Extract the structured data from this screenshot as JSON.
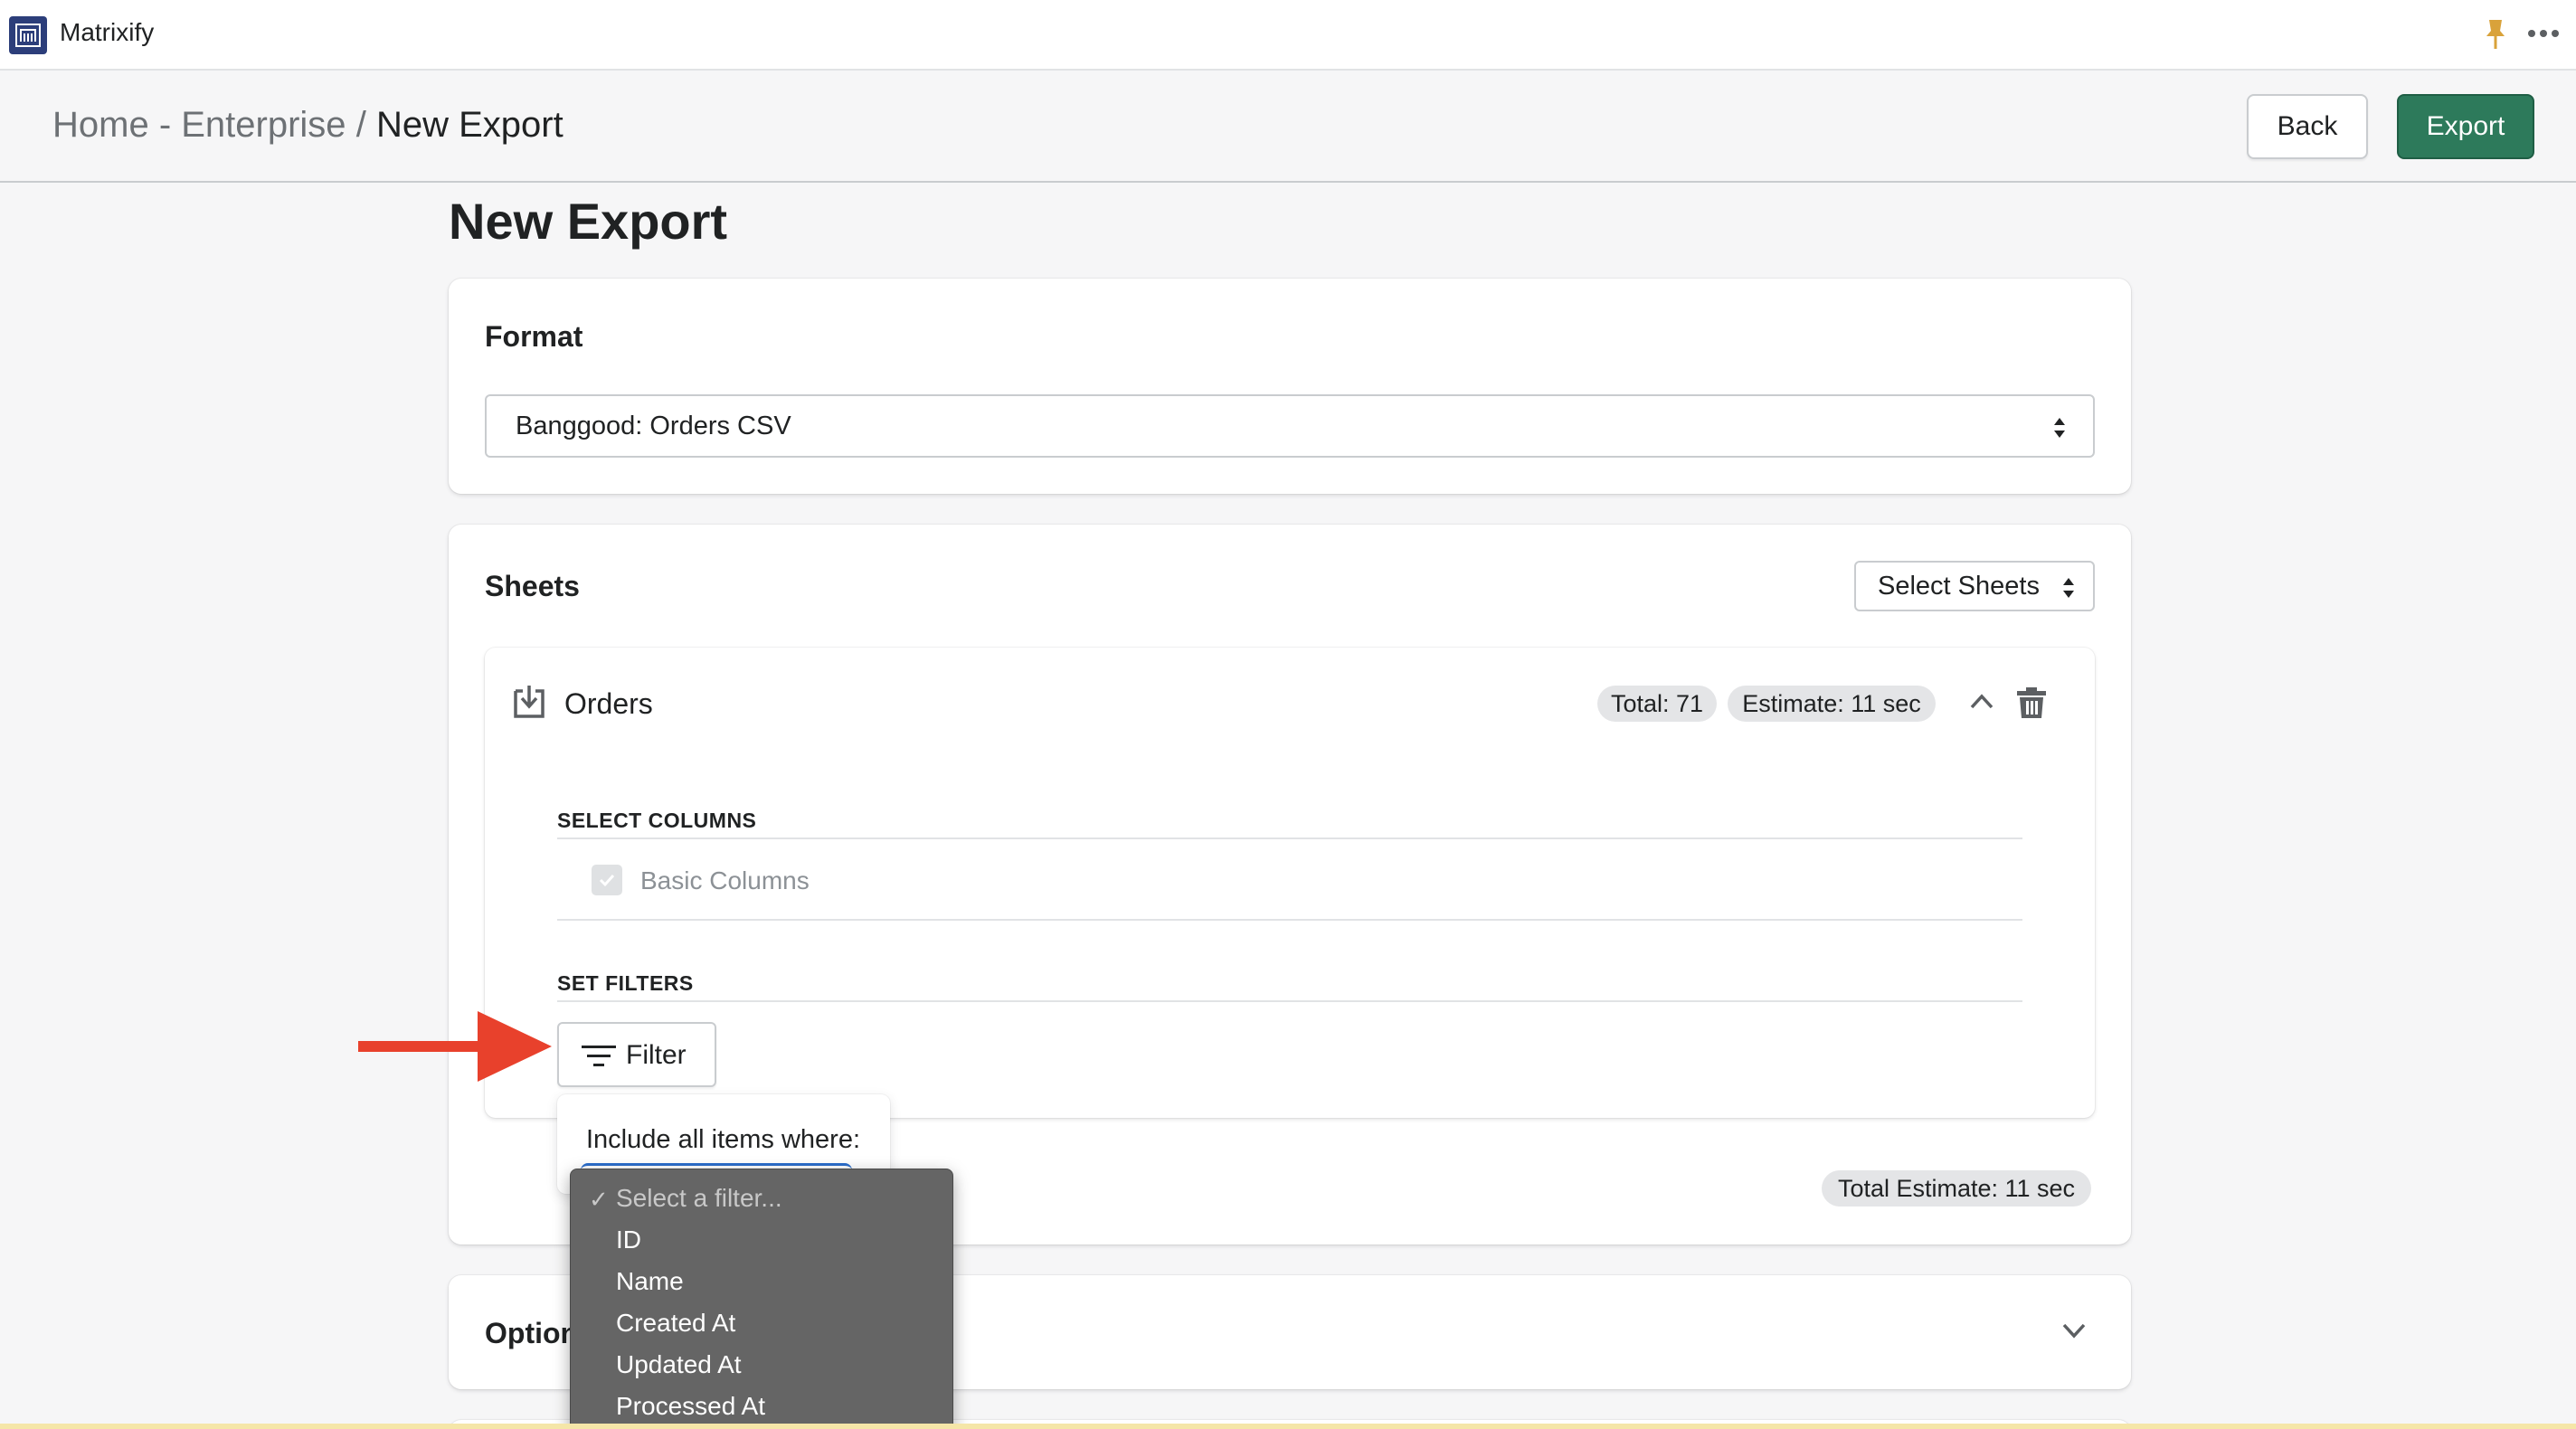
{
  "app": {
    "name": "Matrixify"
  },
  "header": {
    "breadcrumb": {
      "root": "Home - Enterprise",
      "separator": "/",
      "current": "New Export"
    },
    "back_label": "Back",
    "export_label": "Export"
  },
  "page": {
    "title": "New Export"
  },
  "format": {
    "title": "Format",
    "selected": "Banggood: Orders CSV"
  },
  "sheets": {
    "title": "Sheets",
    "select_label": "Select Sheets",
    "orders": {
      "title": "Orders",
      "total_badge": "Total: 71",
      "estimate_badge": "Estimate: 11 sec",
      "select_columns_label": "SELECT COLUMNS",
      "basic_columns_label": "Basic Columns",
      "set_filters_label": "SET FILTERS",
      "filter_button_label": "Filter"
    },
    "total_estimate": "Total Estimate: 11 sec"
  },
  "filter_popover": {
    "label": "Include all items where:",
    "options": [
      "Select a filter...",
      "ID",
      "Name",
      "Created At",
      "Updated At",
      "Processed At"
    ],
    "selected_check": "✓"
  },
  "options": {
    "title": "Option"
  },
  "colors": {
    "primary_button": "#2d7a5b",
    "annotation_arrow": "#e8412c",
    "dropdown_bg": "#656565"
  }
}
